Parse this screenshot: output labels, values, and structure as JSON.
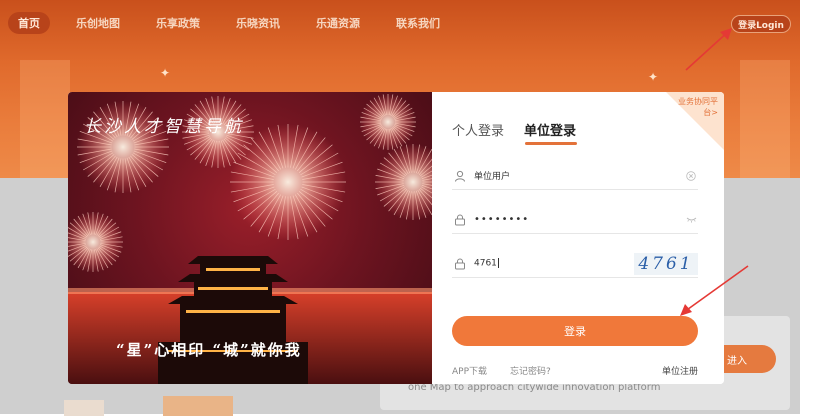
{
  "nav": {
    "items": [
      "首页",
      "乐创地图",
      "乐享政策",
      "乐晓资讯",
      "乐通资源",
      "联系我们"
    ],
    "login_label": "登录Login"
  },
  "background": {
    "card_text": "one Map to approach citywide innovation platform",
    "enter_label": "进入"
  },
  "photo": {
    "title": "长沙人才智慧导航",
    "caption": "“星”心相印 “城”就你我"
  },
  "login": {
    "corner_link": "业务协同平台>",
    "tabs": [
      "个人登录",
      "单位登录"
    ],
    "active_tab": "单位登录",
    "username": "单位用户",
    "password_mask": "••••••••",
    "captcha_input": "4761",
    "captcha_image": "4761",
    "submit_label": "登录",
    "app_download": "APP下载",
    "forgot_password": "忘记密码?",
    "register": "单位注册"
  },
  "colors": {
    "accent": "#f0783a",
    "header": "#e06a2c",
    "annotation_arrow": "#e53935"
  }
}
